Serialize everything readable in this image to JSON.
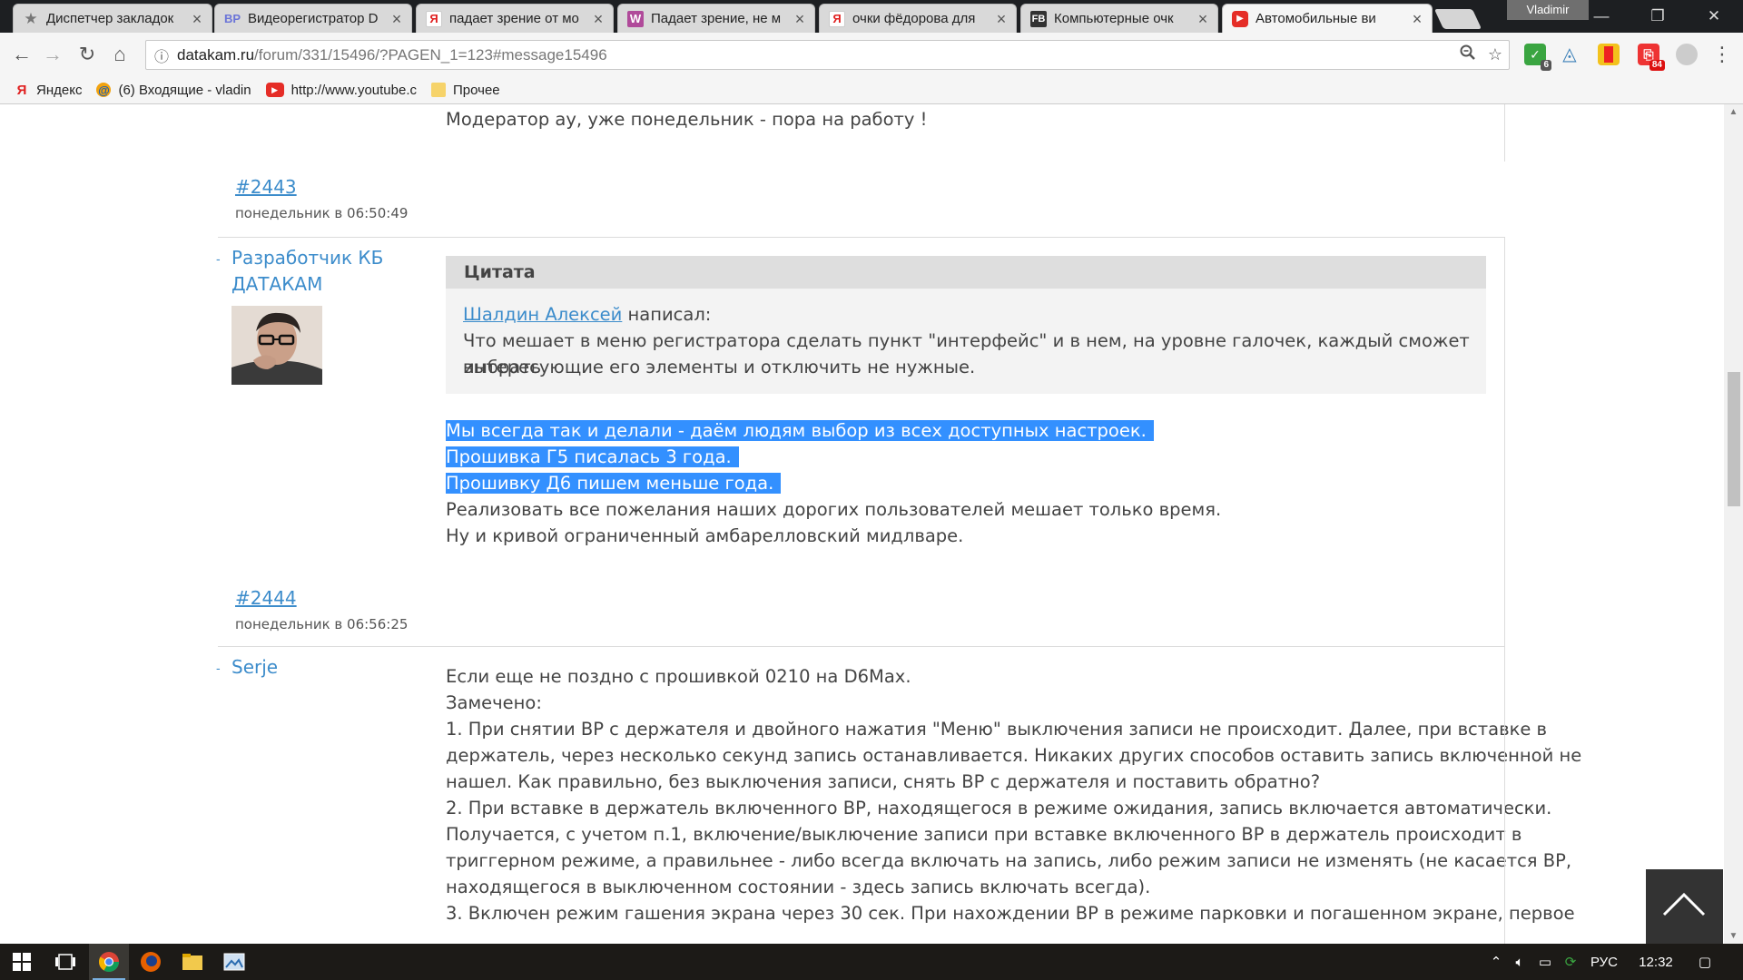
{
  "browser": {
    "tabs": [
      {
        "label": "Диспетчер закладок",
        "icon": "star-icon",
        "active": false
      },
      {
        "label": "Видеорегистратор D",
        "icon": "bp-favicon",
        "active": false
      },
      {
        "label": "падает зрение от мо",
        "icon": "yandex-favicon",
        "active": false
      },
      {
        "label": "Падает зрение, не м",
        "icon": "w-favicon",
        "active": false
      },
      {
        "label": "очки фёдорова для",
        "icon": "yandex-favicon",
        "active": false
      },
      {
        "label": "Компьютерные очк",
        "icon": "fb-favicon",
        "active": false
      },
      {
        "label": "Автомобильные ви",
        "icon": "youtube-favicon",
        "active": true
      }
    ],
    "user": "Vladimir",
    "url": {
      "host": "datakam.ru",
      "path": "/forum/331/15496/?PAGEN_1=123#message15496"
    },
    "bookmarks": [
      {
        "label": "Яндекс",
        "icon": "yandex-icon"
      },
      {
        "label": "(6) Входящие - vladin",
        "icon": "mail-icon"
      },
      {
        "label": "http://www.youtube.c",
        "icon": "youtube-icon"
      },
      {
        "label": "Прочее",
        "icon": "folder-icon"
      }
    ],
    "extensions": [
      {
        "name": "shield-check-ext",
        "badge": "6"
      },
      {
        "name": "triangle-ext",
        "badge": ""
      },
      {
        "name": "bookmark-ext",
        "badge": ""
      },
      {
        "name": "stamp-ext",
        "badge": "84"
      },
      {
        "name": "globe-ext",
        "badge": ""
      }
    ]
  },
  "forum": {
    "prev_post_tail": "Модератор ау, уже понедельник - пора на работу !",
    "posts": [
      {
        "number": "#2443",
        "date": "понедельник в 06:50:49",
        "author_line1": "Разработчик КБ",
        "author_line2": "ДАТАКАМ",
        "quote": {
          "title": "Цитата",
          "author": "Шалдин Алексей",
          "verb": " написал:",
          "lines": [
            "Что мешает в меню регистратора сделать пункт \"интерфейс\" и в нем, на уровне галочек, каждый сможет выбрать",
            "интересующие его элементы и отключить не нужные."
          ]
        },
        "highlighted_lines": [
          "Мы всегда так и делали - даём людям выбор из всех доступных настроек.",
          "Прошивка Г5 писалась 3 года.",
          "Прошивку Д6 пишем меньше года."
        ],
        "lines": [
          "Реализовать все пожелания наших дорогих пользователей мешает только время.",
          "Ну и кривой ограниченный амбарелловский мидлваре."
        ]
      },
      {
        "number": "#2444",
        "date": "понедельник в 06:56:25",
        "author_line1": "Serje",
        "lines": [
          "Если еще не поздно с прошивкой 0210 на D6Max.",
          "Замечено:",
          "1. При снятии ВР с держателя и двойного нажатия \"Меню\" выключения записи не происходит. Далее, при вставке в",
          "держатель, через несколько секунд запись останавливается. Никаких других способов оставить запись включенной не",
          "нашел. Как правильно, без выключения записи, снять ВР с держателя и поставить обратно?",
          "2. При вставке в держатель включенного ВР, находящегося в режиме ожидания, запись включается автоматически.",
          "Получается, с учетом п.1, включение/выключение записи при вставке включенного ВР в держатель происходит в",
          "триггерном режиме, а правильнее - либо всегда включать на запись, либо режим записи не изменять (не касается ВР,",
          "находящегося в выключенном состоянии - здесь запись включать всегда).",
          "3. Включен режим гашения экрана через 30 сек. При нахождении ВР в режиме парковки и погашенном экране, первое"
        ]
      }
    ]
  },
  "taskbar": {
    "lang": "РУС",
    "time": "12:32"
  }
}
